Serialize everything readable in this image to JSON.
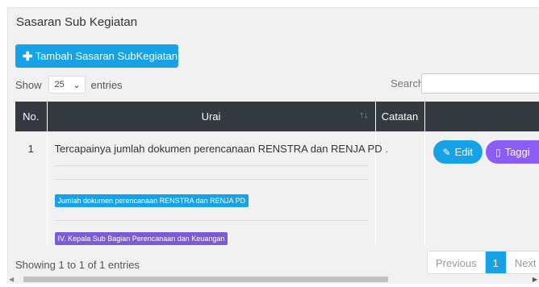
{
  "panel": {
    "title": "Sasaran Sub Kegiatan"
  },
  "toolbar": {
    "add_label": "Tambah Sasaran SubKegiatan"
  },
  "length": {
    "show_label": "Show",
    "selected": "25",
    "entries_label": "entries"
  },
  "search": {
    "label": "Search:",
    "value": ""
  },
  "table": {
    "headers": [
      "No.",
      "Urai",
      "Catatan",
      ""
    ],
    "rows": [
      {
        "no": "1",
        "urai": "Tercapainya jumlah dokumen perencanaan RENSTRA dan RENJA PD",
        "indicator_badge": "Jumlah dokumen perencanaan RENSTRA dan RENJA PD",
        "unit_badge": "IV. Kepala Sub Bagian Perencanaan dan Keuangan",
        "catatan": ".",
        "edit_label": "Edit",
        "tag_label": "Taggi"
      }
    ]
  },
  "footer": {
    "info": "Showing 1 to 1 of 1 entries",
    "pagination": {
      "previous": "Previous",
      "current": "1",
      "next": "Next"
    }
  },
  "icons": {
    "add": "plus-icon",
    "sort": "sort-icon",
    "edit": "pencil-icon",
    "tag": "tag-icon",
    "select": "chevron-down-icon"
  },
  "colors": {
    "primary": "#17a2e8",
    "purple": "#8b5cf6",
    "header": "#343a40"
  }
}
